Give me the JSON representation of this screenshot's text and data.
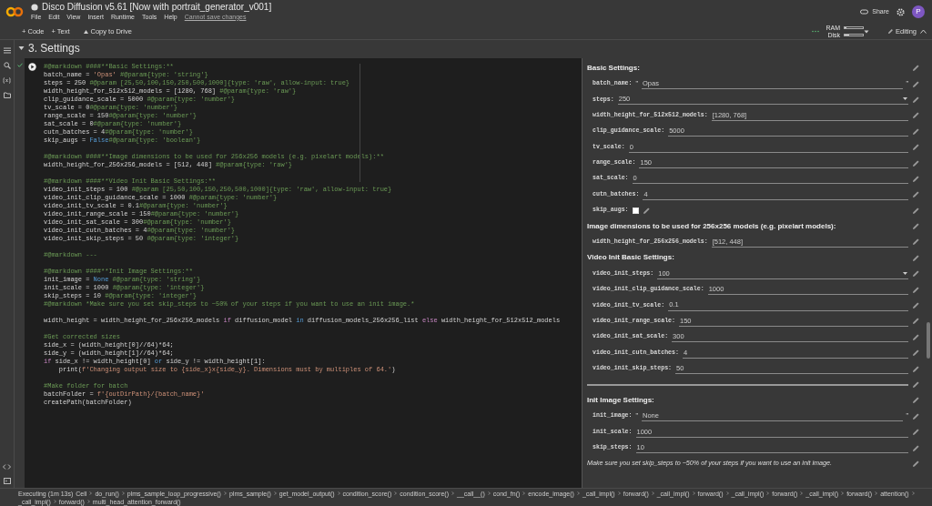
{
  "header": {
    "title": "Disco Diffusion v5.61 [Now with portrait_generator_v001]",
    "menu": [
      "File",
      "Edit",
      "View",
      "Insert",
      "Runtime",
      "Tools",
      "Help"
    ],
    "save_notice": "Cannot save changes",
    "share": "Share",
    "avatar": "P"
  },
  "toolbar": {
    "buttons": [
      {
        "kind": "add",
        "label": "+ Code"
      },
      {
        "kind": "add",
        "label": "+ Text"
      },
      {
        "kind": "drive",
        "label": "Copy to Drive"
      }
    ],
    "resources": [
      {
        "label": "RAM",
        "level": 0.12
      },
      {
        "label": "Disk",
        "level": 0.25
      }
    ],
    "mode": "Editing"
  },
  "section": {
    "title": "3. Settings",
    "expanded": true
  },
  "cell": {
    "executed": true,
    "code": [
      {
        "segs": [
          {
            "kind": "c",
            "text": "#@markdown ####**Basic Settings:**"
          }
        ]
      },
      {
        "segs": [
          {
            "kind": "p",
            "text": "batch_name = "
          },
          {
            "kind": "s",
            "text": "'Opas'"
          },
          {
            "kind": "c",
            "text": " #@param{type: 'string'}"
          }
        ]
      },
      {
        "segs": [
          {
            "kind": "p",
            "text": "steps = 250 "
          },
          {
            "kind": "c",
            "text": "#@param [25,50,100,150,250,500,1000]{type: 'raw', allow-input: true}"
          }
        ]
      },
      {
        "segs": [
          {
            "kind": "p",
            "text": "width_height_for_512x512_models = [1280, 768] "
          },
          {
            "kind": "c",
            "text": "#@param{type: 'raw'}"
          }
        ]
      },
      {
        "segs": [
          {
            "kind": "p",
            "text": "clip_guidance_scale = 5000 "
          },
          {
            "kind": "c",
            "text": "#@param{type: 'number'}"
          }
        ]
      },
      {
        "segs": [
          {
            "kind": "p",
            "text": "tv_scale = 0"
          },
          {
            "kind": "c",
            "text": "#@param{type: 'number'}"
          }
        ]
      },
      {
        "segs": [
          {
            "kind": "p",
            "text": "range_scale = 150"
          },
          {
            "kind": "c",
            "text": "#@param{type: 'number'}"
          }
        ]
      },
      {
        "segs": [
          {
            "kind": "p",
            "text": "sat_scale = 0"
          },
          {
            "kind": "c",
            "text": "#@param{type: 'number'}"
          }
        ]
      },
      {
        "segs": [
          {
            "kind": "p",
            "text": "cutn_batches = 4"
          },
          {
            "kind": "c",
            "text": "#@param{type: 'number'}"
          }
        ]
      },
      {
        "segs": [
          {
            "kind": "p",
            "text": "skip_augs = "
          },
          {
            "kind": "b",
            "text": "False"
          },
          {
            "kind": "c",
            "text": "#@param{type: 'boolean'}"
          }
        ]
      },
      {
        "gap": true,
        "segs": [
          {
            "kind": "c",
            "text": "#@markdown ####**Image dimensions to be used for 256x256 models (e.g. pixelart models):**"
          }
        ]
      },
      {
        "segs": [
          {
            "kind": "p",
            "text": "width_height_for_256x256_models = [512, 448] "
          },
          {
            "kind": "c",
            "text": "#@param{type: 'raw'}"
          }
        ]
      },
      {
        "gap": true,
        "segs": [
          {
            "kind": "c",
            "text": "#@markdown ####**Video Init Basic Settings:**"
          }
        ]
      },
      {
        "segs": [
          {
            "kind": "p",
            "text": "video_init_steps = 100 "
          },
          {
            "kind": "c",
            "text": "#@param [25,50,100,150,250,500,1000]{type: 'raw', allow-input: true}"
          }
        ]
      },
      {
        "segs": [
          {
            "kind": "p",
            "text": "video_init_clip_guidance_scale = 1000 "
          },
          {
            "kind": "c",
            "text": "#@param{type: 'number'}"
          }
        ]
      },
      {
        "segs": [
          {
            "kind": "p",
            "text": "video_init_tv_scale = 0.1"
          },
          {
            "kind": "c",
            "text": "#@param{type: 'number'}"
          }
        ]
      },
      {
        "segs": [
          {
            "kind": "p",
            "text": "video_init_range_scale = 150"
          },
          {
            "kind": "c",
            "text": "#@param{type: 'number'}"
          }
        ]
      },
      {
        "segs": [
          {
            "kind": "p",
            "text": "video_init_sat_scale = 300"
          },
          {
            "kind": "c",
            "text": "#@param{type: 'number'}"
          }
        ]
      },
      {
        "segs": [
          {
            "kind": "p",
            "text": "video_init_cutn_batches = 4"
          },
          {
            "kind": "c",
            "text": "#@param{type: 'number'}"
          }
        ]
      },
      {
        "segs": [
          {
            "kind": "p",
            "text": "video_init_skip_steps = 50 "
          },
          {
            "kind": "c",
            "text": "#@param{type: 'integer'}"
          }
        ]
      },
      {
        "gap": true,
        "segs": [
          {
            "kind": "c",
            "text": "#@markdown ---"
          }
        ]
      },
      {
        "gap": true,
        "segs": [
          {
            "kind": "c",
            "text": "#@markdown ####**Init Image Settings:**"
          }
        ]
      },
      {
        "segs": [
          {
            "kind": "p",
            "text": "init_image = "
          },
          {
            "kind": "b",
            "text": "None"
          },
          {
            "kind": "c",
            "text": " #@param{type: 'string'}"
          }
        ]
      },
      {
        "segs": [
          {
            "kind": "p",
            "text": "init_scale = 1000 "
          },
          {
            "kind": "c",
            "text": "#@param{type: 'integer'}"
          }
        ]
      },
      {
        "segs": [
          {
            "kind": "p",
            "text": "skip_steps = 10 "
          },
          {
            "kind": "c",
            "text": "#@param{type: 'integer'}"
          }
        ]
      },
      {
        "segs": [
          {
            "kind": "c",
            "text": "#@markdown *Make sure you set skip_steps to ~50% of your steps if you want to use an init image.*"
          }
        ]
      },
      {
        "gap": true,
        "segs": [
          {
            "kind": "p",
            "text": "width_height = width_height_for_256x256_models "
          },
          {
            "kind": "k",
            "text": "if"
          },
          {
            "kind": "p",
            "text": " diffusion_model "
          },
          {
            "kind": "b",
            "text": "in"
          },
          {
            "kind": "p",
            "text": " diffusion_models_256x256_list "
          },
          {
            "kind": "k",
            "text": "else"
          },
          {
            "kind": "p",
            "text": " width_height_for_512x512_models"
          }
        ]
      },
      {
        "gap": true,
        "segs": [
          {
            "kind": "c",
            "text": "#Get corrected sizes"
          }
        ]
      },
      {
        "segs": [
          {
            "kind": "p",
            "text": "side_x = (width_height[0]//64)*64;"
          }
        ]
      },
      {
        "segs": [
          {
            "kind": "p",
            "text": "side_y = (width_height[1]//64)*64;"
          }
        ]
      },
      {
        "segs": [
          {
            "kind": "k",
            "text": "if"
          },
          {
            "kind": "p",
            "text": " side_x != width_height[0] "
          },
          {
            "kind": "b",
            "text": "or"
          },
          {
            "kind": "p",
            "text": " side_y != width_height[1]:"
          }
        ]
      },
      {
        "segs": [
          {
            "kind": "p",
            "text": "    print("
          },
          {
            "kind": "s",
            "text": "f'Changing output size to {side_x}x{side_y}. Dimensions must by multiples of 64.'"
          },
          {
            "kind": "p",
            "text": ")"
          }
        ]
      },
      {
        "gap": true,
        "segs": [
          {
            "kind": "c",
            "text": "#Make folder for batch"
          }
        ]
      },
      {
        "segs": [
          {
            "kind": "p",
            "text": "batchFolder = "
          },
          {
            "kind": "s",
            "text": "f'{outDirPath}/{batch_name}'"
          }
        ]
      },
      {
        "segs": [
          {
            "kind": "p",
            "text": "createPath(batchFolder)"
          }
        ]
      }
    ],
    "form": [
      {
        "kind": "heading",
        "text": "Basic Settings:"
      },
      {
        "kind": "text",
        "label": "batch_name:",
        "value": "Opas",
        "open_quote": "\"",
        "close_quote": "\""
      },
      {
        "kind": "dropdown",
        "label": "steps:",
        "value": "250"
      },
      {
        "kind": "field",
        "label": "width_height_for_512x512_models:",
        "value": "[1280, 768]"
      },
      {
        "kind": "field",
        "label": "clip_guidance_scale:",
        "value": "5000"
      },
      {
        "kind": "field",
        "label": "tv_scale:",
        "value": "0"
      },
      {
        "kind": "field",
        "label": "range_scale:",
        "value": "150"
      },
      {
        "kind": "field",
        "label": "sat_scale:",
        "value": "0"
      },
      {
        "kind": "field",
        "label": "cutn_batches:",
        "value": "4"
      },
      {
        "kind": "checkbox",
        "label": "skip_augs:",
        "checked": false
      },
      {
        "kind": "heading",
        "text": "Image dimensions to be used for 256x256 models (e.g. pixelart models):"
      },
      {
        "kind": "field",
        "label": "width_height_for_256x256_models:",
        "value": "[512, 448]"
      },
      {
        "kind": "heading",
        "text": "Video Init Basic Settings:"
      },
      {
        "kind": "dropdown",
        "label": "video_init_steps:",
        "value": "100"
      },
      {
        "kind": "field",
        "label": "video_init_clip_guidance_scale:",
        "value": "1000"
      },
      {
        "kind": "field",
        "label": "video_init_tv_scale:",
        "value": "0.1"
      },
      {
        "kind": "field",
        "label": "video_init_range_scale:",
        "value": "150"
      },
      {
        "kind": "field",
        "label": "video_init_sat_scale:",
        "value": "300"
      },
      {
        "kind": "field",
        "label": "video_init_cutn_batches:",
        "value": "4"
      },
      {
        "kind": "field",
        "label": "video_init_skip_steps:",
        "value": "50"
      },
      {
        "kind": "divider"
      },
      {
        "kind": "heading",
        "text": "Init Image Settings:"
      },
      {
        "kind": "text",
        "label": "init_image:",
        "value": "None",
        "open_quote": "\"",
        "close_quote": "\""
      },
      {
        "kind": "field",
        "label": "init_scale:",
        "value": "1000"
      },
      {
        "kind": "field",
        "label": "skip_steps:",
        "value": "10"
      },
      {
        "kind": "note",
        "text": "Make sure you set skip_steps to ~50% of your steps if you want to use an init image."
      }
    ]
  },
  "status_bar": {
    "text": "Executing (1m 13s)",
    "breadcrumbs": [
      "Cell",
      "do_run()",
      "plms_sample_loop_progressive()",
      "plms_sample()",
      "get_model_output()",
      "condition_score()",
      "condition_score()",
      "__call__()",
      "cond_fn()",
      "encode_image()",
      "_call_impl()",
      "forward()",
      "_call_impl()",
      "forward()",
      "_call_impl()",
      "forward()",
      "_call_impl()",
      "forward()",
      "attention()",
      "_call_impl()",
      "forward()",
      "multi_head_attention_forward()"
    ]
  }
}
